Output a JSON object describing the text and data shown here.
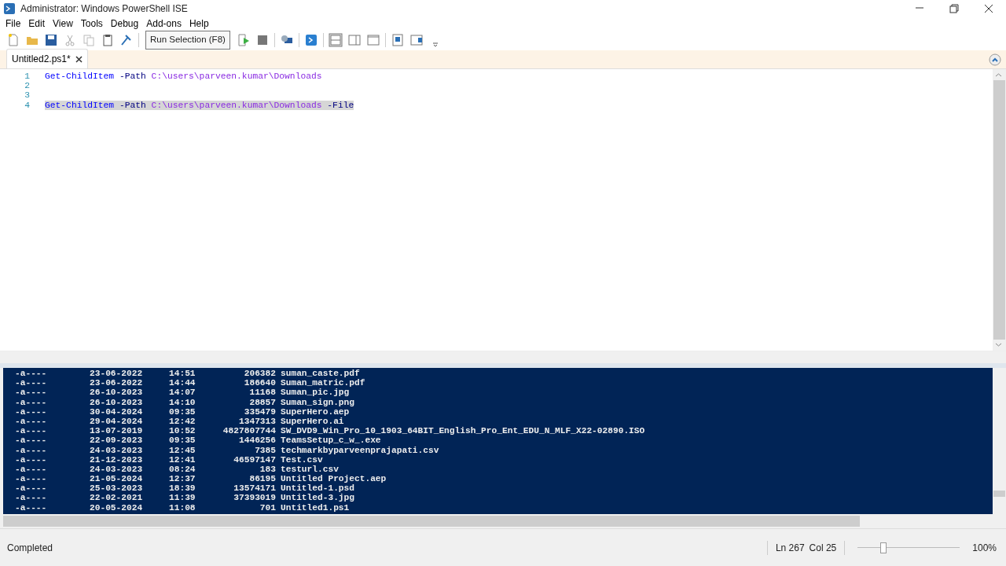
{
  "window": {
    "title": "Administrator: Windows PowerShell ISE"
  },
  "menu": [
    "File",
    "Edit",
    "View",
    "Tools",
    "Debug",
    "Add-ons",
    "Help"
  ],
  "toolbar": {
    "tooltip": "Run Selection (F8)"
  },
  "tabs": [
    {
      "label": "Untitled2.ps1*",
      "selected": true
    }
  ],
  "editor": {
    "lines": [
      {
        "number": "1",
        "selected": false,
        "tokens": [
          {
            "text": "Get-ChildItem",
            "kind": "command"
          },
          {
            "text": " -Path",
            "kind": "parameter"
          },
          {
            "text": " C:\\users\\parveen.kumar\\Downloads",
            "kind": "argument"
          }
        ]
      },
      {
        "number": "2",
        "selected": false
      },
      {
        "number": "3",
        "selected": false
      },
      {
        "number": "4",
        "selected": true,
        "tokens": [
          {
            "text": "Get-ChildItem",
            "kind": "command"
          },
          {
            "text": " -Path",
            "kind": "parameter"
          },
          {
            "text": " C:\\users\\parveen.kumar\\Downloads",
            "kind": "argument"
          },
          {
            "text": " -File",
            "kind": "parameter"
          }
        ]
      }
    ]
  },
  "console": {
    "rows": [
      {
        "mode": "-a----",
        "date": "23-06-2022",
        "time": "14:51",
        "length": "206382",
        "name": "suman_caste.pdf"
      },
      {
        "mode": "-a----",
        "date": "23-06-2022",
        "time": "14:44",
        "length": "186640",
        "name": "Suman_matric.pdf"
      },
      {
        "mode": "-a----",
        "date": "26-10-2023",
        "time": "14:07",
        "length": "11168",
        "name": "Suman_pic.jpg"
      },
      {
        "mode": "-a----",
        "date": "26-10-2023",
        "time": "14:10",
        "length": "28857",
        "name": "Suman_sign.png"
      },
      {
        "mode": "-a----",
        "date": "30-04-2024",
        "time": "09:35",
        "length": "335479",
        "name": "SuperHero.aep"
      },
      {
        "mode": "-a----",
        "date": "29-04-2024",
        "time": "12:42",
        "length": "1347313",
        "name": "SuperHero.ai"
      },
      {
        "mode": "-a----",
        "date": "13-07-2019",
        "time": "10:52",
        "length": "4827807744",
        "name": "SW_DVD9_Win_Pro_10_1903_64BIT_English_Pro_Ent_EDU_N_MLF_X22-02890.ISO"
      },
      {
        "mode": "-a----",
        "date": "22-09-2023",
        "time": "09:35",
        "length": "1446256",
        "name": "TeamsSetup_c_w_.exe"
      },
      {
        "mode": "-a----",
        "date": "24-03-2023",
        "time": "12:45",
        "length": "7385",
        "name": "techmarkbyparveenprajapati.csv"
      },
      {
        "mode": "-a----",
        "date": "21-12-2023",
        "time": "12:41",
        "length": "46597147",
        "name": "Test.csv"
      },
      {
        "mode": "-a----",
        "date": "24-03-2023",
        "time": "08:24",
        "length": "183",
        "name": "testurl.csv"
      },
      {
        "mode": "-a----",
        "date": "21-05-2024",
        "time": "12:37",
        "length": "86195",
        "name": "Untitled Project.aep"
      },
      {
        "mode": "-a----",
        "date": "25-03-2023",
        "time": "18:39",
        "length": "13574171",
        "name": "Untitled-1.psd"
      },
      {
        "mode": "-a----",
        "date": "22-02-2021",
        "time": "11:39",
        "length": "37393019",
        "name": "Untitled-3.jpg"
      },
      {
        "mode": "-a----",
        "date": "20-05-2024",
        "time": "11:08",
        "length": "701",
        "name": "Untitled1.ps1"
      }
    ]
  },
  "status_bar": {
    "status": "Completed",
    "line": "Ln 267",
    "column": "Col 25",
    "zoom": {
      "level": 0.25
    },
    "zoom_reading": "100%"
  }
}
